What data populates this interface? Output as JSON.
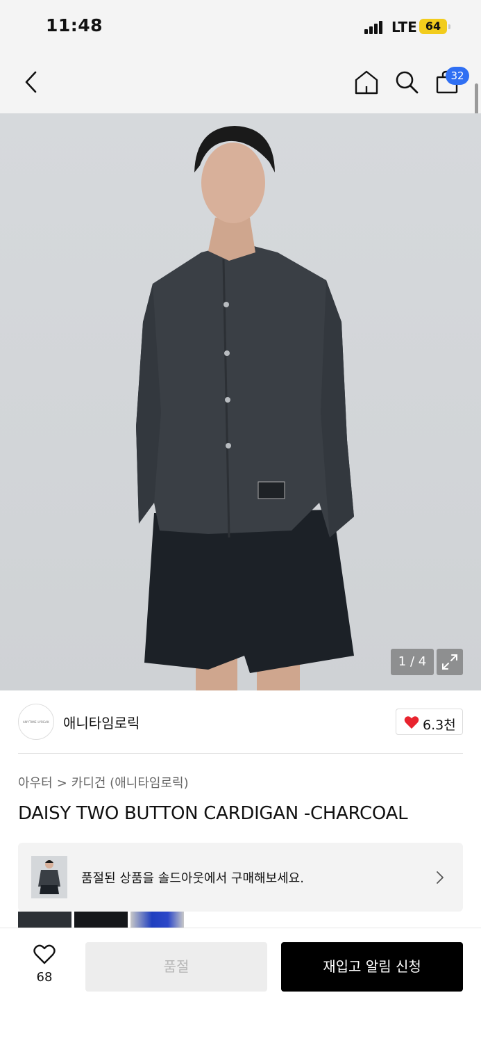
{
  "status_bar": {
    "time": "11:48",
    "network": "LTE",
    "battery": "64"
  },
  "nav": {
    "back_icon": "chevron-left-icon",
    "home_icon": "home-icon",
    "search_icon": "search-icon",
    "bag_icon": "shopping-bag-icon",
    "cart_count": "32"
  },
  "product_image": {
    "counter": "1 / 4",
    "zoom_icon": "expand-icon"
  },
  "brand": {
    "logo_text": "ANYTIME LYREAK",
    "name": "애니타임로릭",
    "like_icon": "heart-icon",
    "likes": "6.3천"
  },
  "breadcrumb": {
    "category": "아우터",
    "separator": ">",
    "subcategory": "카디건 (애니타임로릭)"
  },
  "product": {
    "title": "DAISY TWO BUTTON CARDIGAN -CHARCOAL"
  },
  "soldout_banner": {
    "text": "품절된 상품을 솔드아웃에서 구매해보세요.",
    "chevron_icon": "chevron-right-icon"
  },
  "bottom_bar": {
    "wish_icon": "heart-outline-icon",
    "wish_count": "68",
    "soldout_label": "품절",
    "restock_label": "재입고 알림 신청"
  },
  "colors": {
    "accent_badge": "#2f6ff3",
    "primary_button": "#000000",
    "disabled_button": "#ededed",
    "heart": "#e8232e",
    "battery": "#f2cc1c"
  }
}
